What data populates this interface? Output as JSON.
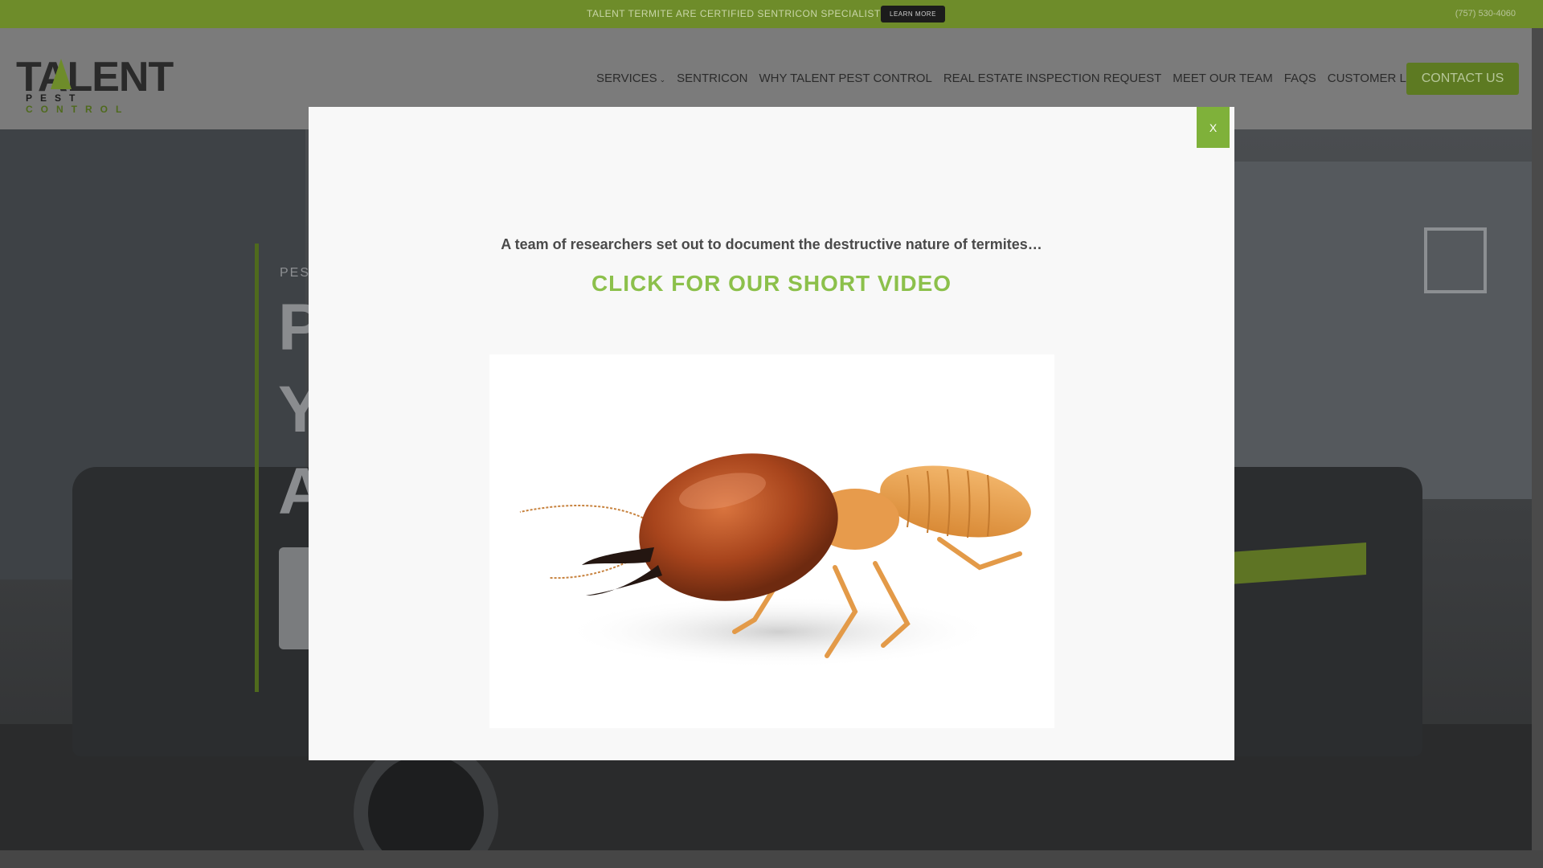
{
  "topbar": {
    "message": "TALENT TERMITE ARE CERTIFIED SENTRICON SPECIALISTS!",
    "learn_more_label": "LEARN MORE",
    "phone": "(757) 530-4060"
  },
  "header": {
    "logo": {
      "word": "TALENT",
      "sub_part1": "PEST",
      "sub_part2": "CONTROL"
    },
    "nav": [
      {
        "label": "SERVICES",
        "has_dropdown": true
      },
      {
        "label": "SENTRICON"
      },
      {
        "label": "WHY TALENT PEST CONTROL"
      },
      {
        "label": "REAL ESTATE INSPECTION REQUEST"
      },
      {
        "label": "MEET OUR TEAM"
      },
      {
        "label": "FAQS"
      },
      {
        "label": "CUSTOMER LOGIN"
      }
    ],
    "contact_label": "CONTACT US"
  },
  "hero": {
    "kicker": "PEST",
    "lines": [
      "P",
      "Y",
      "A"
    ]
  },
  "modal": {
    "close_label": "X",
    "intro": "A team of researchers set out to document the destructive nature of termites…",
    "cta": "CLICK FOR OUR SHORT VIDEO",
    "thumbnail_subject": "termite"
  },
  "colors": {
    "topbar": "#6e8c2a",
    "accent_green": "#8cc04b",
    "close_green": "#7fb13a",
    "modal_bg": "#f8f8f8"
  }
}
